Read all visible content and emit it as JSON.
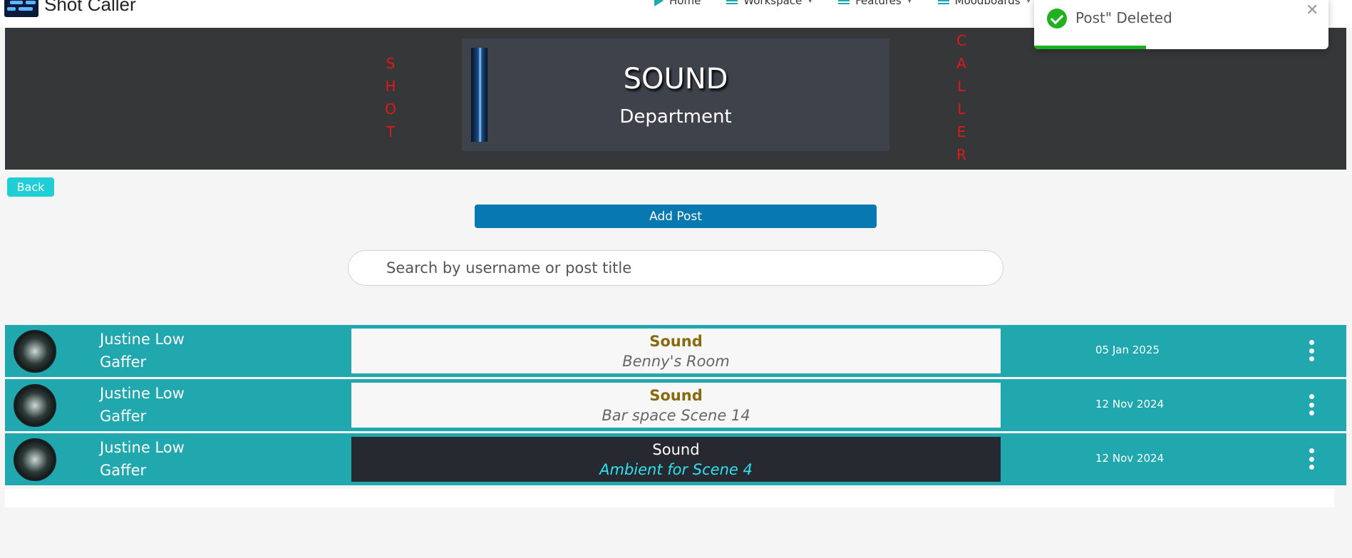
{
  "app": {
    "brand": "Shot Caller"
  },
  "nav": {
    "items": [
      {
        "label": "Home",
        "icon": "play-icon"
      },
      {
        "label": "Workspace",
        "icon": "menu-icon"
      },
      {
        "label": "Features",
        "icon": "menu-icon"
      },
      {
        "label": "Moodboards",
        "icon": "menu-icon"
      }
    ]
  },
  "banner": {
    "left_vertical": "S H O T",
    "right_vertical": "C A L L E R",
    "title": "SOUND",
    "subtitle": "Department"
  },
  "actions": {
    "back": "Back",
    "add_post": "Add Post"
  },
  "search": {
    "placeholder": "Search by username or post title"
  },
  "posts": [
    {
      "username": "Justine Low",
      "role": "Gaffer",
      "title": "Sound",
      "subtitle": "Benny's Room",
      "date": "05 Jan 2025",
      "style": "light"
    },
    {
      "username": "Justine Low",
      "role": "Gaffer",
      "title": "Sound",
      "subtitle": "Bar space Scene 14",
      "date": "12 Nov 2024",
      "style": "light"
    },
    {
      "username": "Justine Low",
      "role": "Gaffer",
      "title": "Sound",
      "subtitle": "Ambient for Scene 4",
      "date": "12 Nov 2024",
      "style": "dark"
    }
  ],
  "toast": {
    "message": "Post\" Deleted",
    "progress": 0.38
  },
  "colors": {
    "accent": "#21a7ae",
    "primary": "#0878b0",
    "banner": "#353738",
    "red_text": "#e01818"
  }
}
